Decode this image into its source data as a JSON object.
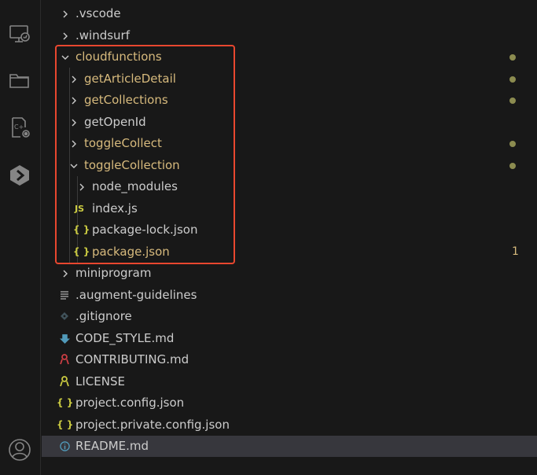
{
  "activity_bar": {
    "icons": [
      "remote-explorer-icon",
      "explorer-files-icon",
      "extensions-remote-icon",
      "deploy-icon",
      "account-icon"
    ]
  },
  "explorer": {
    "items": [
      {
        "label": ".vscode",
        "kind": "folder",
        "expanded": false,
        "modified": false
      },
      {
        "label": ".windsurf",
        "kind": "folder",
        "expanded": false,
        "modified": false
      },
      {
        "label": "cloudfunctions",
        "kind": "folder",
        "expanded": true,
        "modified": true
      },
      {
        "label": "getArticleDetail",
        "kind": "folder",
        "expanded": false,
        "modified": true
      },
      {
        "label": "getCollections",
        "kind": "folder",
        "expanded": false,
        "modified": true
      },
      {
        "label": "getOpenId",
        "kind": "folder",
        "expanded": false,
        "modified": false
      },
      {
        "label": "toggleCollect",
        "kind": "folder",
        "expanded": false,
        "modified": true
      },
      {
        "label": "toggleCollection",
        "kind": "folder",
        "expanded": true,
        "modified": true
      },
      {
        "label": "node_modules",
        "kind": "folder",
        "expanded": false,
        "modified": false
      },
      {
        "label": "index.js",
        "kind": "js",
        "modified": false
      },
      {
        "label": "package-lock.json",
        "kind": "json",
        "modified": false
      },
      {
        "label": "package.json",
        "kind": "json",
        "modified": true,
        "badge": "1"
      },
      {
        "label": "miniprogram",
        "kind": "folder",
        "expanded": false,
        "modified": false
      },
      {
        "label": ".augment-guidelines",
        "kind": "text",
        "modified": false
      },
      {
        "label": ".gitignore",
        "kind": "git",
        "modified": false
      },
      {
        "label": "CODE_STYLE.md",
        "kind": "md-down",
        "modified": false
      },
      {
        "label": "CONTRIBUTING.md",
        "kind": "md-contrib",
        "modified": false
      },
      {
        "label": "LICENSE",
        "kind": "license",
        "modified": false
      },
      {
        "label": "project.config.json",
        "kind": "json",
        "modified": false
      },
      {
        "label": "project.private.config.json",
        "kind": "json",
        "modified": false
      },
      {
        "label": "README.md",
        "kind": "info",
        "modified": false,
        "selected": true
      }
    ]
  },
  "icon_glyphs": {
    "js": "JS",
    "json": "{ }"
  },
  "colors": {
    "modified_text": "#d7ba7d",
    "modified_dot": "#8c8c50",
    "highlight_border": "#e8472f",
    "json_icon": "#cbcb41",
    "js_icon": "#cbcb41",
    "info_icon": "#519aba",
    "selected_row": "#37373d"
  }
}
